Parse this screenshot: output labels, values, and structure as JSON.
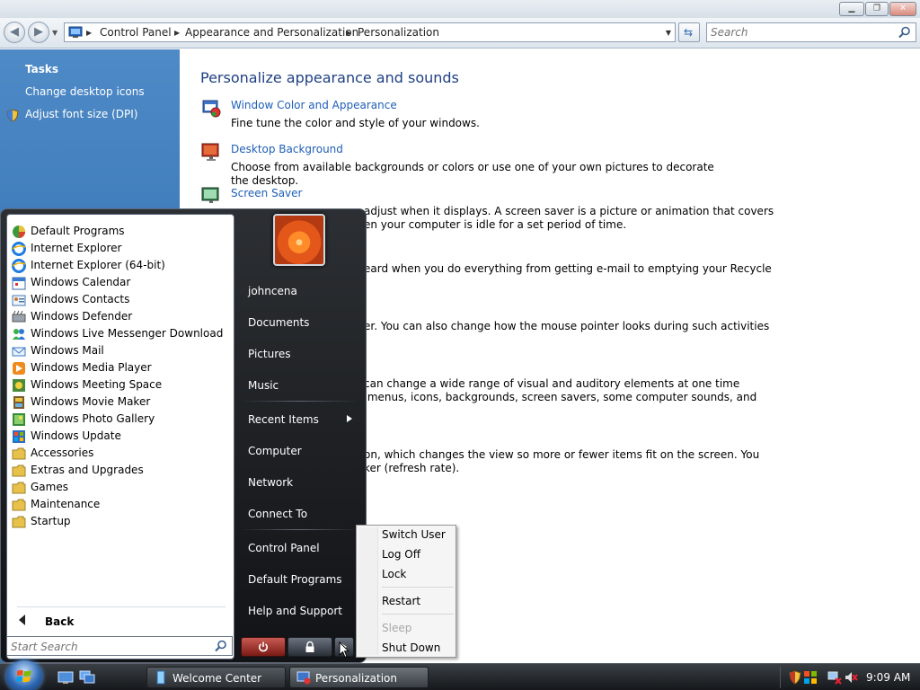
{
  "window": {
    "address": {
      "crumbs": [
        "Control Panel",
        "Appearance and Personalization",
        "Personalization"
      ]
    },
    "search": {
      "placeholder": "Search"
    }
  },
  "tasks": {
    "title": "Tasks",
    "links": [
      "Change desktop icons",
      "Adjust font size (DPI)"
    ]
  },
  "content": {
    "title": "Personalize appearance and sounds",
    "items": [
      {
        "title": "Window Color and Appearance",
        "desc": "Fine tune the color and style of your windows."
      },
      {
        "title": "Desktop Background",
        "desc": "Choose from available backgrounds or colors or use one of your own pictures to decorate the desktop."
      },
      {
        "title": "Screen Saver",
        "desc": "adjust when it displays. A screen saver is a picture or animation that covers\nen your computer is idle for a set period of time."
      }
    ],
    "fragments": [
      "eard when you do everything from getting e-mail to emptying your Recycle",
      "er. You can also change how the mouse pointer looks during such activities",
      "can change a wide range of visual and auditory elements at one time\n menus, icons, backgrounds, screen savers, some computer sounds, and",
      "on, which changes the view so more or fewer items fit on the screen. You\nker (refresh rate)."
    ]
  },
  "start_menu": {
    "programs": [
      {
        "label": "Default Programs",
        "icon": "default-programs-icon"
      },
      {
        "label": "Internet Explorer",
        "icon": "internet-explorer-icon"
      },
      {
        "label": "Internet Explorer (64-bit)",
        "icon": "internet-explorer-icon"
      },
      {
        "label": "Windows Calendar",
        "icon": "calendar-icon"
      },
      {
        "label": "Windows Contacts",
        "icon": "contacts-icon"
      },
      {
        "label": "Windows Defender",
        "icon": "defender-icon"
      },
      {
        "label": "Windows Live Messenger Download",
        "icon": "messenger-icon"
      },
      {
        "label": "Windows Mail",
        "icon": "mail-icon"
      },
      {
        "label": "Windows Media Player",
        "icon": "media-player-icon"
      },
      {
        "label": "Windows Meeting Space",
        "icon": "meeting-space-icon"
      },
      {
        "label": "Windows Movie Maker",
        "icon": "movie-maker-icon"
      },
      {
        "label": "Windows Photo Gallery",
        "icon": "photo-gallery-icon"
      },
      {
        "label": "Windows Update",
        "icon": "windows-update-icon"
      },
      {
        "label": "Accessories",
        "icon": "folder-icon"
      },
      {
        "label": "Extras and Upgrades",
        "icon": "folder-icon"
      },
      {
        "label": "Games",
        "icon": "folder-icon"
      },
      {
        "label": "Maintenance",
        "icon": "folder-icon"
      },
      {
        "label": "Startup",
        "icon": "folder-icon"
      }
    ],
    "back_label": "Back",
    "search_placeholder": "Start Search",
    "user_name": "johncena",
    "right_links": [
      "Documents",
      "Pictures",
      "Music",
      "Recent Items",
      "Computer",
      "Network",
      "Connect To",
      "Control Panel",
      "Default Programs",
      "Help and Support"
    ]
  },
  "power_menu": {
    "items": [
      {
        "label": "Switch User",
        "enabled": true
      },
      {
        "label": "Log Off",
        "enabled": true
      },
      {
        "label": "Lock",
        "enabled": true
      },
      {
        "label": "Restart",
        "enabled": true
      },
      {
        "label": "Sleep",
        "enabled": false
      },
      {
        "label": "Shut Down",
        "enabled": true
      }
    ]
  },
  "taskbar": {
    "buttons": [
      "Welcome Center",
      "Personalization"
    ],
    "clock": "9:09 AM"
  },
  "colors": {
    "task_pane": "#3b78b8",
    "link": "#1e5eb7",
    "heading": "#1e3f83",
    "start_menu_dark": "#15181b"
  }
}
